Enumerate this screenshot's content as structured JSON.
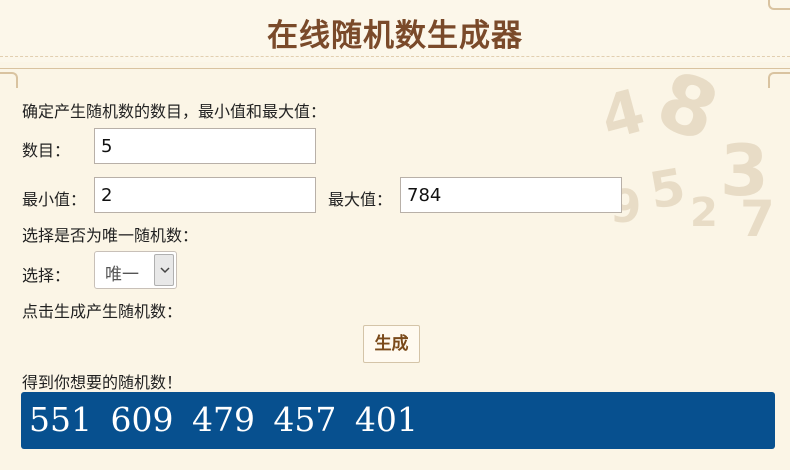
{
  "header": {
    "title": "在线随机数生成器"
  },
  "form": {
    "intro": "确定产生随机数的数目，最小值和最大值：",
    "count_label": "数目：",
    "count_value": "5",
    "min_label": "最小值：",
    "min_value": "2",
    "max_label": "最大值：",
    "max_value": "784",
    "unique_prompt": "选择是否为唯一随机数：",
    "select_label": "选择：",
    "select_value": "唯一",
    "generate_prompt": "点击生成产生随机数：",
    "generate_button": "生成",
    "result_prompt": "得到你想要的随机数！",
    "result_value": "551  609  479  457  401"
  },
  "colors": {
    "background": "#fbf5e6",
    "title": "#7a4a2a",
    "result_bg": "#07508f",
    "button_text": "#7a4a1a"
  }
}
